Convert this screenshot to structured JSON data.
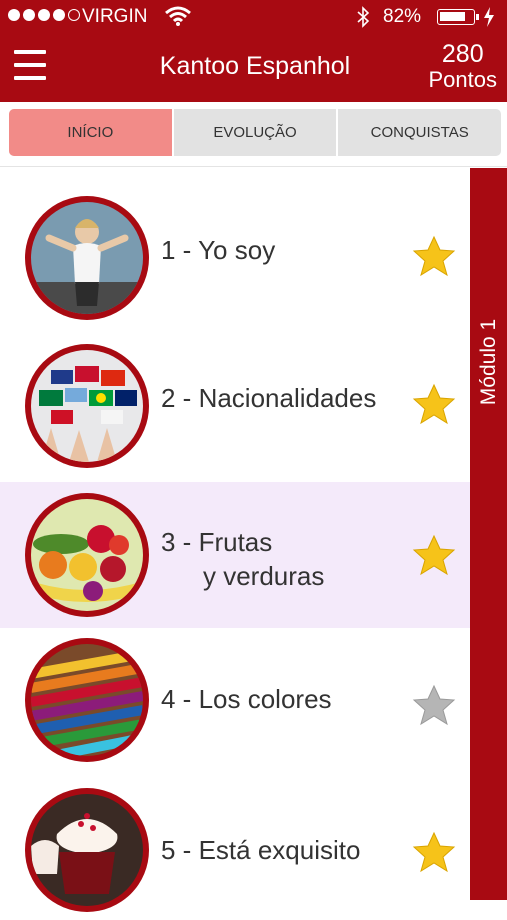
{
  "status_bar": {
    "carrier": "VIRGIN",
    "battery_percent": "82%",
    "battery_level": 0.82
  },
  "header": {
    "title": "Kantoo Espanhol",
    "points_value": "280",
    "points_label": "Pontos"
  },
  "tabs": [
    {
      "label": "INÍCIO",
      "active": true
    },
    {
      "label": "EVOLUÇÃO",
      "active": false
    },
    {
      "label": "CONQUISTAS",
      "active": false
    }
  ],
  "module_label": "Módulo 1",
  "lessons": [
    {
      "title": "1 - Yo soy",
      "title_line2": "",
      "starred": true,
      "image": "woman-pointing"
    },
    {
      "title": "2 - Nacionalidades",
      "title_line2": "",
      "starred": true,
      "image": "flags"
    },
    {
      "title": "3 - Frutas",
      "title_line2": "y verduras",
      "starred": true,
      "highlighted": true,
      "image": "fruits-vegetables"
    },
    {
      "title": "4 - Los colores",
      "title_line2": "",
      "starred": false,
      "image": "colored-pencils"
    },
    {
      "title": "5 - Está exquisito",
      "title_line2": "",
      "starred": true,
      "image": "cupcakes"
    }
  ],
  "colors": {
    "brand_red": "#a80a12",
    "active_tab": "#f28b88",
    "highlight_row": "#f4eafa",
    "star_gold": "#f6c319",
    "star_gray": "#b5b5b5"
  }
}
